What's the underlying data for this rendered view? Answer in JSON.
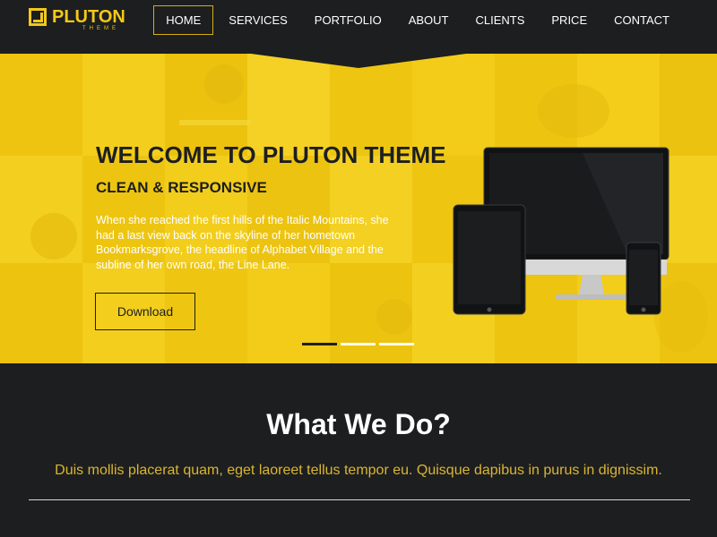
{
  "brand": {
    "name": "PLUTON",
    "tagline": "THEME"
  },
  "nav": {
    "items": [
      {
        "label": "HOME",
        "active": true
      },
      {
        "label": "SERVICES",
        "active": false
      },
      {
        "label": "PORTFOLIO",
        "active": false
      },
      {
        "label": "ABOUT",
        "active": false
      },
      {
        "label": "CLIENTS",
        "active": false
      },
      {
        "label": "PRICE",
        "active": false
      },
      {
        "label": "CONTACT",
        "active": false
      }
    ]
  },
  "hero": {
    "title": "WELCOME TO PLUTON THEME",
    "subtitle": "CLEAN & RESPONSIVE",
    "text": "When she reached the first hills of the Italic Mountains, she had a last view back on the skyline of her hometown Bookmarksgrove, the headline of Alphabet Village and the subline of her own road, the Line Lane.",
    "button_label": "Download",
    "slides": {
      "count": 3,
      "active_index": 0
    },
    "image_icon": "devices-illustration"
  },
  "section": {
    "title": "What We Do?",
    "lead": "Duis mollis placerat quam, eget laoreet tellus tempor eu. Quisque dapibus in purus in dignissim."
  },
  "colors": {
    "accent": "#f2c918",
    "dark": "#1d1e20",
    "lead_text": "#d9b632",
    "hero_bg": "#f2cc10"
  }
}
